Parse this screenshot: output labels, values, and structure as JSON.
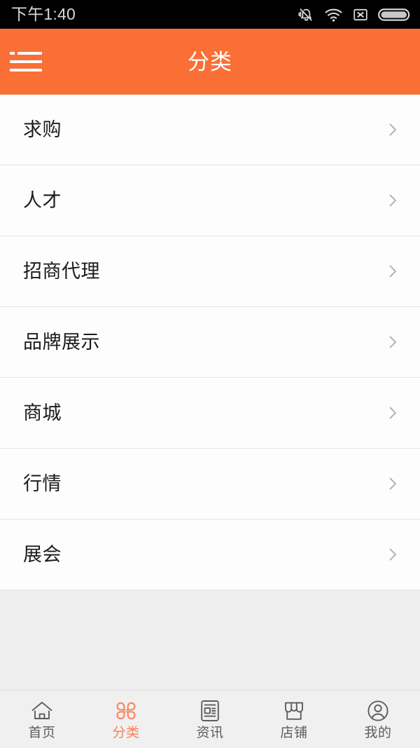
{
  "statusbar": {
    "time": "下午1:40",
    "icons": [
      {
        "name": "bell-muted-icon"
      },
      {
        "name": "wifi-icon"
      },
      {
        "name": "no-sim-icon"
      },
      {
        "name": "battery-icon"
      }
    ]
  },
  "header": {
    "title": "分类",
    "menu_icon": "hamburger-menu-icon",
    "background_color": "#f96f36",
    "title_color": "#ffffff"
  },
  "list": {
    "items": [
      {
        "label": "求购"
      },
      {
        "label": "人才"
      },
      {
        "label": "招商代理"
      },
      {
        "label": "品牌展示"
      },
      {
        "label": "商城"
      },
      {
        "label": "行情"
      },
      {
        "label": "展会"
      }
    ],
    "chevron_icon": "chevron-right-icon",
    "chevron_color": "#b4b4b4",
    "row_background": "#fdfdfd",
    "separator_color": "#e2e2e2"
  },
  "tabbar": {
    "active_color": "#f98154",
    "inactive_color": "#5d5d5d",
    "background_color": "#f0f0f0",
    "tabs": [
      {
        "label": "首页",
        "icon": "home-icon",
        "active": false
      },
      {
        "label": "分类",
        "icon": "clover-grid-icon",
        "active": true
      },
      {
        "label": "资讯",
        "icon": "news-document-icon",
        "active": false
      },
      {
        "label": "店铺",
        "icon": "storefront-icon",
        "active": false
      },
      {
        "label": "我的",
        "icon": "user-profile-icon",
        "active": false
      }
    ]
  }
}
